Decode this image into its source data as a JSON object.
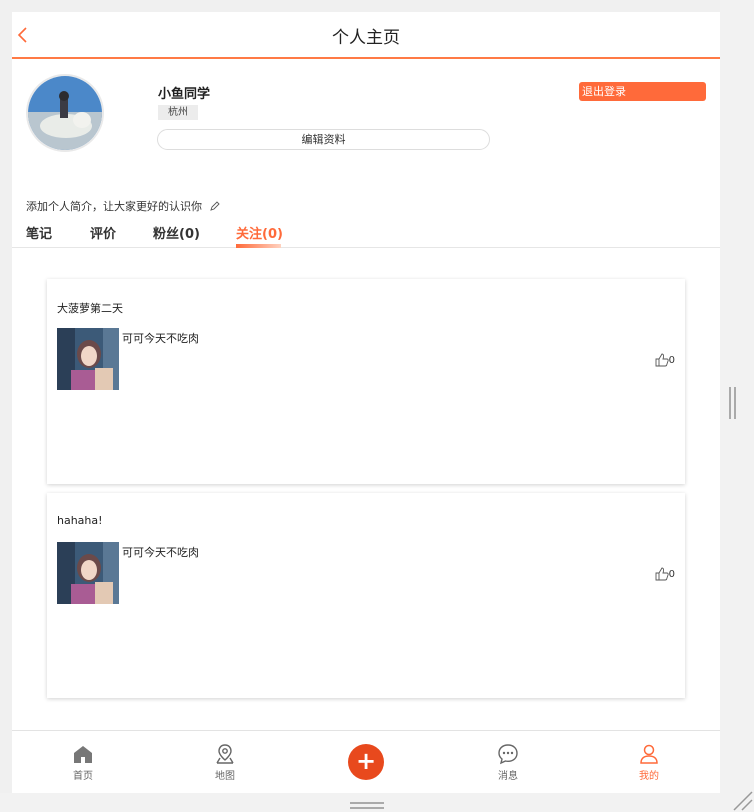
{
  "header": {
    "title": "个人主页"
  },
  "profile": {
    "username": "小鱼同学",
    "city": "杭州",
    "edit_label": "编辑资料",
    "logout_label": "退出登录",
    "bio_prompt": "添加个人简介，让大家更好的认识你"
  },
  "tabs": [
    {
      "label": "笔记"
    },
    {
      "label": "评价"
    },
    {
      "label": "粉丝(0)"
    },
    {
      "label": "关注(0)"
    }
  ],
  "active_tab": "关注(0)",
  "posts": [
    {
      "title": "大菠萝第二天",
      "author": "可可今天不吃肉",
      "likes": "0"
    },
    {
      "title": "hahaha!",
      "author": "可可今天不吃肉",
      "likes": "0"
    }
  ],
  "tabbar": [
    {
      "label": "首页",
      "icon": "home-icon"
    },
    {
      "label": "地图",
      "icon": "map-icon"
    },
    {
      "label": "",
      "icon": "plus-icon"
    },
    {
      "label": "消息",
      "icon": "chat-icon"
    },
    {
      "label": "我的",
      "icon": "user-icon"
    }
  ],
  "colors": {
    "accent": "#ff6a3a",
    "plus": "#e8491d"
  }
}
